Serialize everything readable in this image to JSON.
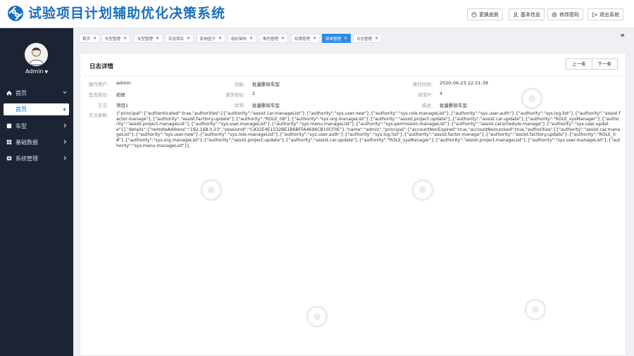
{
  "app": {
    "title": "试验项目计划辅助优化决策系统"
  },
  "top_actions": [
    {
      "label": "更换皮肤",
      "icon": "skin-icon"
    },
    {
      "label": "基本信息",
      "icon": "user-icon"
    },
    {
      "label": "修改密码",
      "icon": "settings-icon"
    },
    {
      "label": "退出系统",
      "icon": "logout-icon"
    }
  ],
  "user": {
    "name": "Admin"
  },
  "sidebar": {
    "items": [
      {
        "label": "首页",
        "icon": "home-icon"
      },
      {
        "label": "车型",
        "icon": "car-icon"
      },
      {
        "label": "基础数据",
        "icon": "database-icon"
      },
      {
        "label": "系统管理",
        "icon": "settings-icon"
      }
    ],
    "sub_item": {
      "label": "首页"
    }
  },
  "tabs": [
    {
      "label": "首页"
    },
    {
      "label": "车型管理"
    },
    {
      "label": "车型管理"
    },
    {
      "label": "实验项目"
    },
    {
      "label": "影响因子"
    },
    {
      "label": "组织架构"
    },
    {
      "label": "角色管理"
    },
    {
      "label": "权限管理"
    },
    {
      "label": "菜单管理",
      "active": true
    },
    {
      "label": "日志管理"
    }
  ],
  "tabs_more": "»",
  "detail": {
    "title": "日志详情",
    "prev": "上一条",
    "next": "下一条",
    "fields": {
      "user_label": "操作用户:",
      "user_value": "admin",
      "func_label": "功能:",
      "func_value": "批量删除车型",
      "time_label": "操作时间:",
      "time_value": "2020-06-23 22:21:39",
      "success_label": "是否成功:",
      "success_value": "初样",
      "url_label": "请求地址:",
      "url_value": "2",
      "ip_label": "请求IP:",
      "ip_value": "4",
      "method_label": "方法:",
      "method_value": "项目1",
      "exception_label": "异常:",
      "exception_value": "批量删除车型",
      "desc_label": "描述:",
      "desc_value": "批量删除车型",
      "params_label": "方法参数:",
      "params_value": "{\"principal\":{\"authenticated\":true,\"authorities\":[{\"authority\":\"assist.car.manageList\"},{\"authority\":\"sys.user.new\"},{\"authority\":\"sys.role.manageList\"},{\"authority\":\"sys.user.auth\"},{\"authority\":\"sys.log.list\"},{\"authority\":\"assist.factor.manage\"},{\"authority\":\"assist.facttory.update\"},{\"authority\":\"ROLE_08\"},{\"authority\":\"sys.org.manageList\"},{\"authority\":\"assist.project.update\"},{\"authority\":\"assist.car.update\"},{\"authority\":\"ROLE_sysManager\"},{\"authority\":\"assist.project.manageList\"},{\"authority\":\"sys.user.manageList\"},{\"authority\":\"sys.menu.manageList\"},{\"authority\":\"sys.permission.manageList\"},{\"authority\":\"assist.carschedule.manage\"},{\"authority\":\"sys.user.update\"}],\"details\":{\"remoteAddress\":\"192.168.0.23\",\"sessionId\":\"CA32E4E1532BE1B6BFFA4696CB10CF0E\"},\"name\":\"admin\",\"principal\":{\"accountNonExpired\":true,\"accountNonLocked\":true,\"authorities\":[{\"authority\":\"assist.car.manageList\"},{\"authority\":\"sys.user.new\"},{\"authority\":\"sys.role.manageList\"},{\"authority\":\"sys.user.auth\"},{\"authority\":\"sys.log.list\"},{\"authority\":\"assist.factor.manage\"},{\"authority\":\"assist.facttory.update\"},{\"authority\":\"ROLE_08\"},{\"authority\":\"sys.org.manageList\"},{\"authority\":\"assist.project.update\"},{\"authority\":\"assist.car.update\"},{\"authority\":\"ROLE_sysManager\"},{\"authority\":\"assist.project.manageList\"},{\"authority\":\"sys.user.manageList\"},{\"authority\":\"sys.menu.manageList\"}],"
    }
  },
  "colors": {
    "brand": "#1b6fbf",
    "sidebar_bg": "#1c2434",
    "active_tab": "#2d8ce6"
  }
}
